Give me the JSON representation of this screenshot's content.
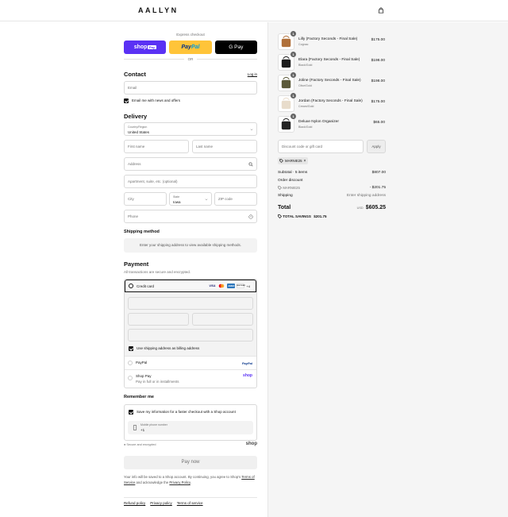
{
  "header": {
    "brand": "AALLYN",
    "cart_icon": "bag-icon"
  },
  "express": {
    "label": "Express checkout",
    "shop_label": "shop",
    "shop_pay_badge": "Pay",
    "paypal_label_a": "Pay",
    "paypal_label_b": "Pal",
    "gpay_label": "G Pay",
    "or_label": "OR"
  },
  "contact": {
    "title": "Contact",
    "login_label": "Log in",
    "email_placeholder": "Email",
    "news_label": "Email me with news and offers"
  },
  "delivery": {
    "title": "Delivery",
    "country_label": "Country/Region",
    "country_value": "United States",
    "first_name_placeholder": "First name",
    "last_name_placeholder": "Last name",
    "address_placeholder": "Address",
    "apartment_placeholder": "Apartment, suite, etc. (optional)",
    "city_placeholder": "City",
    "state_label": "State",
    "state_value": "Iowa",
    "zip_placeholder": "ZIP code",
    "phone_placeholder": "Phone"
  },
  "shipping_method": {
    "title": "Shipping method",
    "message": "Enter your shipping address to view available shipping methods."
  },
  "payment": {
    "title": "Payment",
    "subtitle": "All transactions are secure and encrypted.",
    "credit_card_label": "Credit card",
    "card_brands": [
      "VISA",
      "",
      "AMEX",
      "DISCOVER"
    ],
    "more_cards": "+4",
    "billing_label": "Use shipping address as billing address",
    "paypal_label": "PayPal",
    "paypal_logo": "PayPal",
    "shoppay_label": "Shop Pay",
    "shoppay_sub": "Pay in full or in installments",
    "shoppay_logo": "shop"
  },
  "remember": {
    "title": "Remember me",
    "save_label": "Save my information for a faster checkout with a Shop account",
    "phone_label": "Mobile phone number",
    "phone_value": "+1",
    "secure_label": "Secure and encrypted",
    "shop_logo": "shop"
  },
  "pay_now": "Pay now",
  "terms": {
    "text_a": "Your info will be saved to a Shop account. By continuing, you agree to Shop's ",
    "tos_link": "Terms of Service",
    "text_b": " and acknowledge the ",
    "privacy_link": "Privacy Policy",
    "text_c": "."
  },
  "footer": {
    "links": [
      "Refund policy",
      "Privacy policy",
      "Terms of service"
    ]
  },
  "order": {
    "items": [
      {
        "qty": "1",
        "name": "Lilly (Factory Seconds - Final Sale)",
        "variant": "Cognac",
        "price": "$175.00",
        "color": "#b0703a"
      },
      {
        "qty": "1",
        "name": "Elara (Factory Seconds - Final Sale)",
        "variant": "Black/Gold",
        "price": "$198.00",
        "color": "#1c1c1c"
      },
      {
        "qty": "1",
        "name": "Joline (Factory Seconds - Final Sale)",
        "variant": "Olive/Gold",
        "price": "$198.00",
        "color": "#5c5a3a"
      },
      {
        "qty": "1",
        "name": "Jordan (Factory Seconds - Final Sale)",
        "variant": "Cream/Gold",
        "price": "$175.00",
        "color": "#e8dccb"
      },
      {
        "qty": "1",
        "name": "Deluxe Nylon Organizer",
        "variant": "Black/Gold",
        "price": "$65.00",
        "color": "#222222"
      }
    ],
    "discount_placeholder": "Discount code or gift card",
    "apply_label": "Apply",
    "applied_code": "MARNIE25",
    "subtotal_label": "Subtotal · 5 items",
    "subtotal_value": "$807.00",
    "order_discount_label": "Order discount",
    "discount_code": "MARNIE25",
    "discount_value": "- $201.75",
    "shipping_label": "Shipping",
    "shipping_value": "Enter shipping address",
    "total_label": "Total",
    "currency": "USD",
    "total_value": "$605.25",
    "savings_label": "TOTAL SAVINGS",
    "savings_value": "$201.75"
  }
}
